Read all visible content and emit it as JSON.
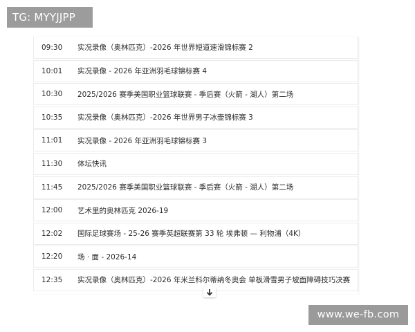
{
  "tg_label": "TG: MYYJJPP",
  "watermark": "www.we-fb.com",
  "schedule": [
    {
      "time": "09:30",
      "title": "实况录像（奥林匹克）-2026 年世界短道速滑锦标赛 2"
    },
    {
      "time": "10:01",
      "title": "实况录像 - 2026 年亚洲羽毛球锦标赛 4"
    },
    {
      "time": "10:30",
      "title": "2025/2026 赛季美国职业篮球联赛 - 季后赛（火箭 - 湖人）第二场"
    },
    {
      "time": "10:35",
      "title": "实况录像（奥林匹克）-2026 年世界男子冰壶锦标赛 3"
    },
    {
      "time": "11:01",
      "title": "实况录像 - 2026 年亚洲羽毛球锦标赛 3"
    },
    {
      "time": "11:30",
      "title": "体坛快讯"
    },
    {
      "time": "11:45",
      "title": "2025/2026 赛季美国职业篮球联赛 - 季后赛（火箭 - 湖人）第二场"
    },
    {
      "time": "12:00",
      "title": "艺术里的奥林匹克 2026-19"
    },
    {
      "time": "12:02",
      "title": "国际足球赛场 - 25-26 赛季英超联赛第 33 轮 埃弗顿 — 利物浦（4K）"
    },
    {
      "time": "12:20",
      "title": "场 · 面 - 2026-14"
    },
    {
      "time": "12:35",
      "title": "实况录像（奥林匹克）-2026 年米兰科尔蒂纳冬奥会 单板滑雪男子坡面障碍技巧决赛"
    }
  ],
  "icons": {
    "scroll_down": "arrow-down-icon"
  }
}
